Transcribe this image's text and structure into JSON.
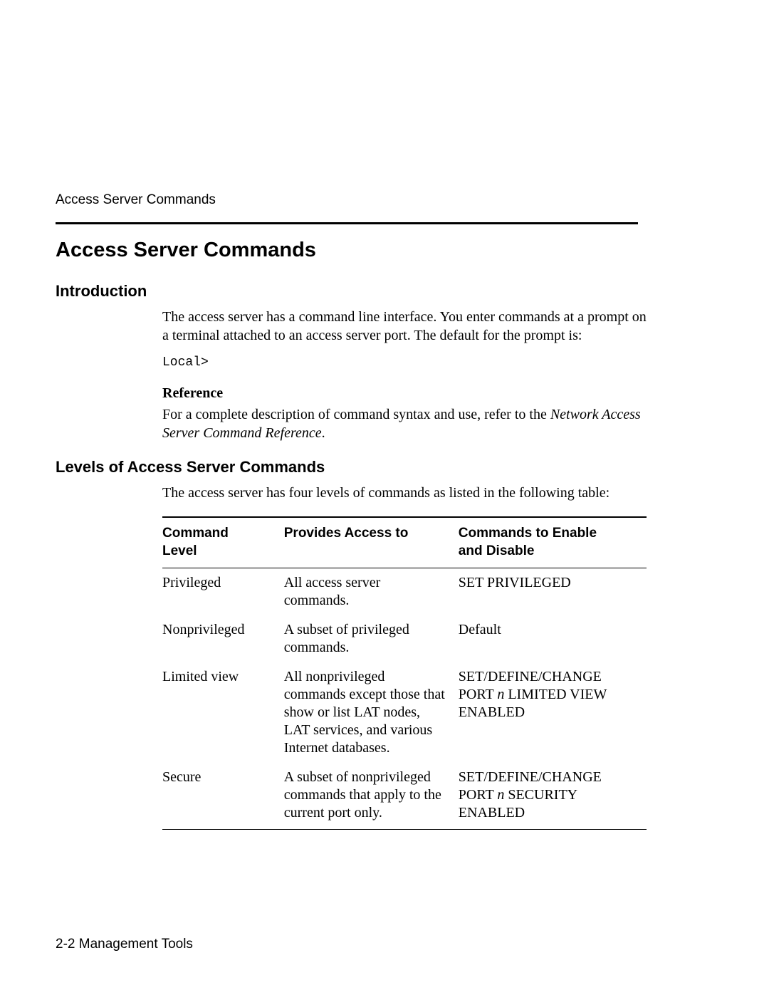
{
  "running_head": "Access Server Commands",
  "title": "Access Server Commands",
  "section1": {
    "heading": "Introduction",
    "para": "The access server has a command line interface. You enter commands at a prompt on a terminal attached to an access server port. The default for the prompt is:",
    "prompt": "Local>",
    "ref_head": "Reference",
    "ref_text_before": "For a complete description of command syntax and use, refer to the ",
    "ref_text_italic": "Network Access Server Command Reference",
    "ref_text_after": "."
  },
  "section2": {
    "heading": "Levels of Access Server Commands",
    "intro": "The access server has four levels of commands as listed in the following table:",
    "table": {
      "headers": {
        "col1_a": "Command",
        "col1_b": "Level",
        "col2": "Provides Access to",
        "col3_a": "Commands to Enable",
        "col3_b": "and Disable"
      },
      "rows": [
        {
          "level": "Privileged",
          "access": "All access server commands.",
          "cmd_line1": "SET PRIVILEGED",
          "cmd_line2_pre": "",
          "cmd_line2_n": "",
          "cmd_line2_post": "",
          "cmd_line3": ""
        },
        {
          "level": "Nonprivileged",
          "access": "A subset of privileged commands.",
          "cmd_line1": "Default",
          "cmd_line2_pre": "",
          "cmd_line2_n": "",
          "cmd_line2_post": "",
          "cmd_line3": ""
        },
        {
          "level": "Limited view",
          "access": "All nonprivileged commands except those that show or list LAT nodes, LAT services, and various Internet databases.",
          "cmd_line1": "SET/DEFINE/CHANGE",
          "cmd_line2_pre": "PORT ",
          "cmd_line2_n": "n",
          "cmd_line2_post": " LIMITED VIEW",
          "cmd_line3": "ENABLED"
        },
        {
          "level": "Secure",
          "access": "A subset of nonprivileged commands that apply to the current port only.",
          "cmd_line1": "SET/DEFINE/CHANGE",
          "cmd_line2_pre": "PORT ",
          "cmd_line2_n": "n",
          "cmd_line2_post": " SECURITY",
          "cmd_line3": "ENABLED"
        }
      ]
    }
  },
  "footer": "2-2  Management Tools"
}
